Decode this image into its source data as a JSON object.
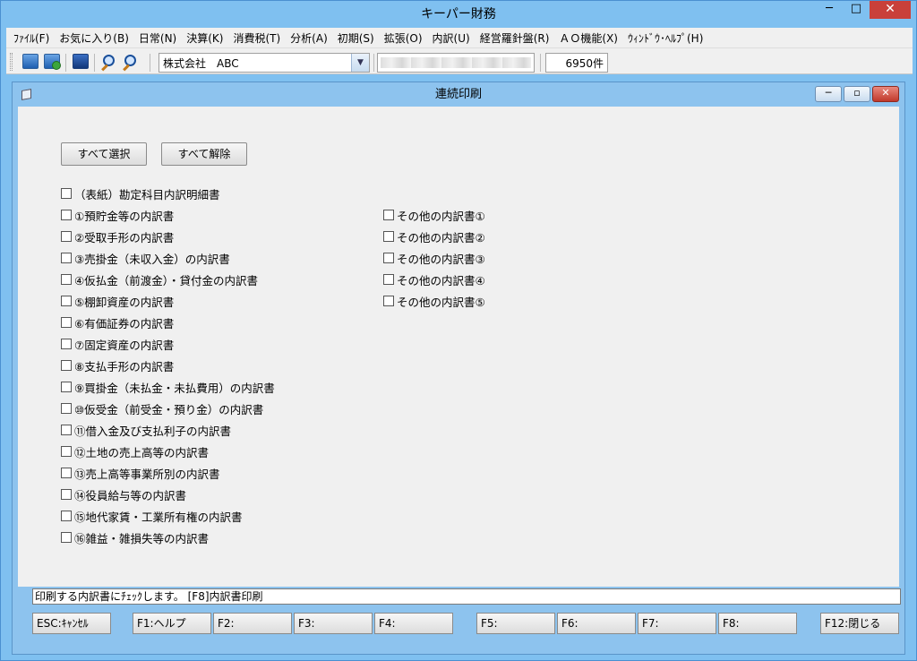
{
  "app": {
    "title": "キーパー財務",
    "win_min": "─",
    "win_max": "□",
    "win_close": "✕"
  },
  "menu": {
    "items": [
      {
        "label": "ﾌｧｲﾙ(F)"
      },
      {
        "label": "お気に入り(B)"
      },
      {
        "label": "日常(N)"
      },
      {
        "label": "決算(K)"
      },
      {
        "label": "消費税(T)"
      },
      {
        "label": "分析(A)"
      },
      {
        "label": "初期(S)"
      },
      {
        "label": "拡張(O)"
      },
      {
        "label": "内訳(U)"
      },
      {
        "label": "経営羅針盤(R)"
      },
      {
        "label": "ＡＯ機能(X)"
      },
      {
        "label": "ｳｨﾝﾄﾞｳ･ﾍﾙﾌﾟ(H)"
      }
    ]
  },
  "toolbar": {
    "company": "株式会社　ABC",
    "dropdown_arrow": "▼",
    "record_count": "6950件"
  },
  "dialog": {
    "title": "連続印刷",
    "min": "─",
    "restore": "▫",
    "close": "✕",
    "select_all": "すべて選択",
    "deselect_all": "すべて解除",
    "cover_item": "（表紙）勘定科目内訳明細書",
    "left_items": [
      "①預貯金等の内訳書",
      "②受取手形の内訳書",
      "③売掛金（未収入金）の内訳書",
      "④仮払金（前渡金）・貸付金の内訳書",
      "⑤棚卸資産の内訳書",
      "⑥有価証券の内訳書",
      "⑦固定資産の内訳書",
      "⑧支払手形の内訳書",
      "⑨買掛金（未払金・未払費用）の内訳書",
      "⑩仮受金（前受金・預り金）の内訳書",
      "⑪借入金及び支払利子の内訳書",
      "⑫土地の売上高等の内訳書",
      "⑬売上高等事業所別の内訳書",
      "⑭役員給与等の内訳書",
      "⑮地代家賃・工業所有権の内訳書",
      "⑯雑益・雑損失等の内訳書"
    ],
    "right_items": [
      "その他の内訳書①",
      "その他の内訳書②",
      "その他の内訳書③",
      "その他の内訳書④",
      "その他の内訳書⑤"
    ],
    "status": "印刷する内訳書にﾁｪｯｸします。 [F8]内訳書印刷",
    "fkeys": {
      "esc": "ESC:ｷｬﾝｾﾙ",
      "f1": "F1:ヘルプ",
      "f2": "F2:",
      "f3": "F3:",
      "f4": "F4:",
      "f5": "F5:",
      "f6": "F6:",
      "f7": "F7:",
      "f8": "F8:",
      "f12": "F12:閉じる"
    }
  }
}
